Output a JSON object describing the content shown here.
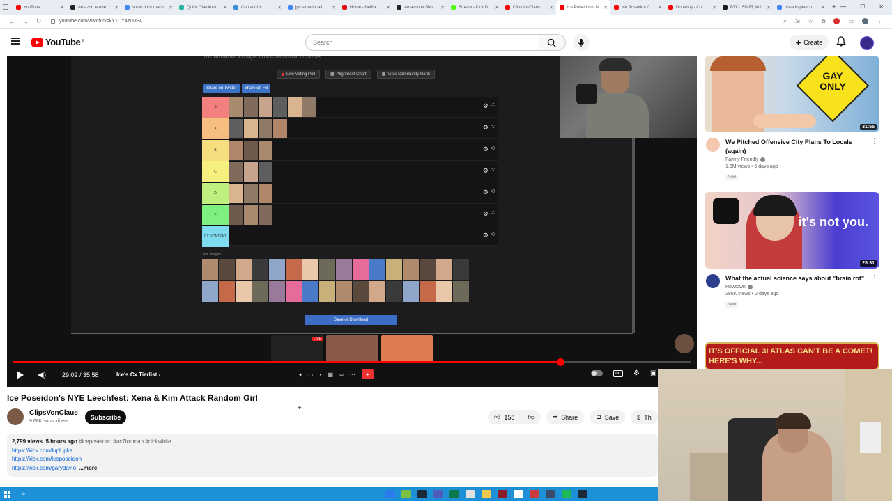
{
  "browser": {
    "tabs": [
      {
        "label": "YouTube",
        "color": "#ff0000"
      },
      {
        "label": "Amazon.ie one",
        "color": "#222222"
      },
      {
        "label": "snow duck mach",
        "color": "#4285f4"
      },
      {
        "label": "Quick Checkout",
        "color": "#26b5a6"
      },
      {
        "label": "Contact Us",
        "color": "#3a8fd6"
      },
      {
        "label": "jps store locati",
        "color": "#4285f4"
      },
      {
        "label": "Home - Netflix",
        "color": "#e50914"
      },
      {
        "label": "Amazon.ie Sho",
        "color": "#222222"
      },
      {
        "label": "Stream - Kick D",
        "color": "#53fc18"
      },
      {
        "label": "ClipsVonClaus",
        "color": "#ff0000"
      },
      {
        "label": "Ice Poseidon's N",
        "color": "#ff0000"
      },
      {
        "label": "Ice Poseidon C",
        "color": "#ff0000"
      },
      {
        "label": "Dopeboy - Co",
        "color": "#ff0000"
      },
      {
        "label": "BTCUSD 87,981",
        "color": "#1a1a1a"
      },
      {
        "label": "posado planch",
        "color": "#4285f4"
      }
    ],
    "active_tab_index": 10,
    "url": "youtube.com/watch?v=kY1OY4zOvE4",
    "new_tab": "+",
    "win_min": "—",
    "win_max": "☐",
    "win_close": "✕"
  },
  "youtube": {
    "logo_text": "YouTube",
    "logo_region": "IE",
    "search_placeholder": "Search",
    "create_label": "Create"
  },
  "player": {
    "stage_note": "This template has 40 images and was last modified 12/29/2025.",
    "buttons": [
      "Live Voting Poll",
      "Alignment Chart",
      "View Community Rank"
    ],
    "share_buttons": [
      "Share on Twitter",
      "Share on FB"
    ],
    "tiers": [
      {
        "label": "S",
        "color": "#f47f7f",
        "count": 6
      },
      {
        "label": "A",
        "color": "#f6bf7f",
        "count": 4
      },
      {
        "label": "B",
        "color": "#f6de7f",
        "count": 3
      },
      {
        "label": "C",
        "color": "#f6f07f",
        "count": 3
      },
      {
        "label": "D",
        "color": "#bff07f",
        "count": 3
      },
      {
        "label": "F",
        "color": "#7ff07f",
        "count": 3
      },
      {
        "label": "CX NONTENT",
        "color": "#7fdcf0",
        "count": 0
      }
    ],
    "pool_label": "Pin Images",
    "save_label": "Save or Download",
    "live_badge": "LIVE",
    "time": "29:02 / 35:58",
    "chapter": "Ice's Cx Tierlist",
    "progress_fraction": 0.807,
    "cc_label": "CC"
  },
  "video": {
    "title": "Ice Poseidon's NYE Leechfest: Xena & Kim Attack Random Girl",
    "channel": "ClipsVonClaus",
    "subscribers": "9.68K subscribers",
    "subscribe_label": "Subscribe",
    "likes": "158",
    "share_label": "Share",
    "save_label": "Save",
    "thanks_label": "Th",
    "views": "2,799 views",
    "age": "5 hours ago",
    "tags": "#iceposeidon #ac7ionman #nickwhite",
    "links": [
      "https://kick.com/luplupka",
      "https://kick.com/iceposeidon",
      "https://kick.com/garydavio"
    ],
    "more_label": "...more"
  },
  "sidebar": [
    {
      "title": "We Pitched Offensive City Plans To Locals (again)",
      "channel": "Family Friendly",
      "stats": "1.6M views • 5 days ago",
      "badge": "New",
      "duration": "31:55",
      "thumb_text": "GAY ONLY",
      "avatar_color": "#f4c9b0"
    },
    {
      "title": "What the actual science says about \"brain rot\"",
      "channel": "Howtown",
      "stats": "295K views • 2 days ago",
      "badge": "New",
      "duration": "25:31",
      "thumb_text": "it's not you.",
      "avatar_color": "#2b3f8c"
    },
    {
      "title": "",
      "channel": "",
      "stats": "",
      "badge": "",
      "duration": "",
      "thumb_text": "IT'S OFFICIAL 3I ATLAS CAN'T BE A COMET! HERE'S WHY...",
      "avatar_color": "#333333"
    }
  ]
}
